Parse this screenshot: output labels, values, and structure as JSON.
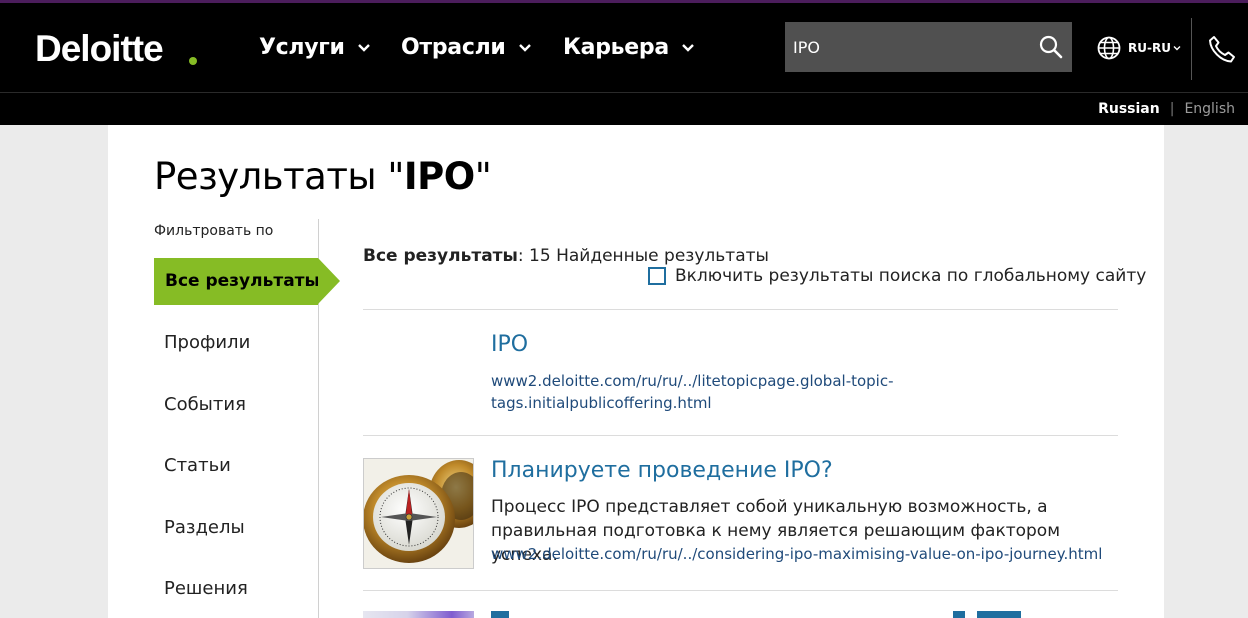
{
  "header": {
    "logo": "Deloitte",
    "nav": [
      {
        "label": "Услуги"
      },
      {
        "label": "Отрасли"
      },
      {
        "label": "Карьера"
      }
    ],
    "search": {
      "value": "IPO",
      "placeholder": ""
    },
    "locale": "RU-RU"
  },
  "language_bar": {
    "active": "Russian",
    "other": "English"
  },
  "page": {
    "title_prefix": "Результаты \"",
    "title_query": "IPO",
    "title_suffix": "\""
  },
  "sidebar": {
    "filter_label": "Фильтровать по",
    "active_item": "Все результаты",
    "items": [
      "Профили",
      "События",
      "Статьи",
      "Разделы",
      "Решения"
    ]
  },
  "results_summary": {
    "label": "Все результаты",
    "count_text": ": 15 Найденные результаты",
    "global_checkbox_label": "Включить результаты поиска по глобальному сайту"
  },
  "results": [
    {
      "title": "IPO",
      "url_line1": "www2.deloitte.com/ru/ru/../litetopicpage.global-topic-",
      "url_line2": "tags.initialpublicoffering.html"
    },
    {
      "title": "Планируете проведение IPO?",
      "description_line1": "Процесс IPO представляет собой уникальную возможность, а",
      "description_line2": "правильная подготовка к нему является решающим фактором успеха.",
      "url": "www2.deloitte.com/ru/ru/../considering-ipo-maximising-value-on-ipo-journey.html",
      "thumbnail": "compass-image"
    }
  ],
  "colors": {
    "brand_green": "#86bc25",
    "link_blue": "#1f6e9f",
    "header_black": "#000000",
    "search_bg": "#505050"
  }
}
